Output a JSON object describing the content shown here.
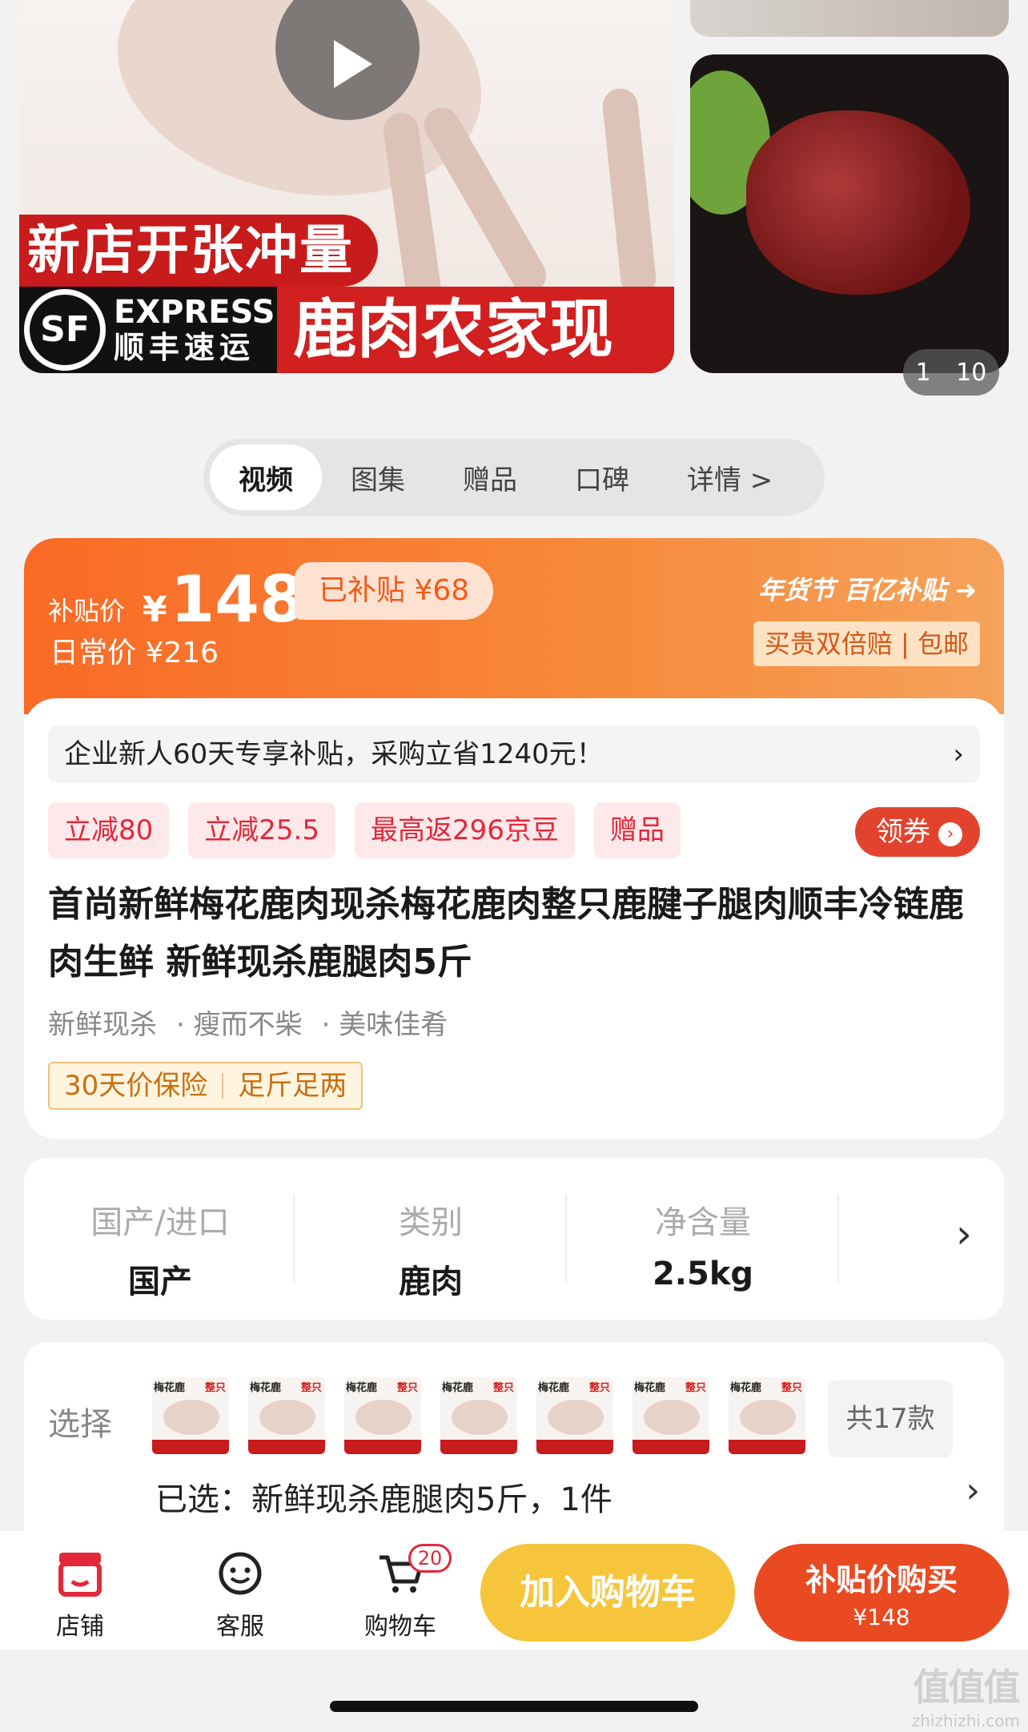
{
  "media": {
    "promo_line": "新店开张冲量",
    "sf_logo": "SF",
    "sf_en": "EXPRESS",
    "sf_cn": "顺丰速运",
    "banner_text": "鹿肉农家现杀",
    "counter_current": "1",
    "counter_total": "10"
  },
  "tabs": [
    {
      "label": "视频",
      "active": true
    },
    {
      "label": "图集"
    },
    {
      "label": "赠品"
    },
    {
      "label": "口碑"
    },
    {
      "label": "详情 >"
    }
  ],
  "price": {
    "subsidy_label": "补贴价",
    "yen": "¥",
    "subsidy_price": "148",
    "saved_text": "已补贴 ¥68",
    "daily_text": "日常价 ¥216",
    "event_text": "年货节 百亿补贴",
    "event_icon": "chevron-circle-icon",
    "badge_text": "买贵双倍赔 | 包邮"
  },
  "notice": {
    "text": "企业新人60天专享补贴，采购立省1240元！",
    "chevron": "›"
  },
  "tags": [
    "立减80",
    "立减25.5",
    "最高返296京豆",
    "赠品"
  ],
  "coupon": {
    "label": "领券",
    "icon": "›"
  },
  "product": {
    "title": "首尚新鲜梅花鹿肉现杀梅花鹿肉整只鹿腱子腿肉顺丰冷链鹿肉生鲜 新鲜现杀鹿腿肉5斤",
    "features": [
      "新鲜现杀",
      "· 瘦而不柴",
      "· 美味佳肴"
    ],
    "services": [
      "30天价保险",
      "足斤足两"
    ]
  },
  "specs": [
    {
      "key": "国产/进口",
      "value": "国产"
    },
    {
      "key": "类别",
      "value": "鹿肉"
    },
    {
      "key": "净含量",
      "value": "2.5kg"
    }
  ],
  "spec_chevron": "›",
  "select": {
    "label": "选择",
    "thumb_text_a": "梅花鹿",
    "thumb_text_b": "整只",
    "thumb_count": 7,
    "more_label": "共17款",
    "selected_text": "已选：新鲜现杀鹿腿肉5斤，1件",
    "chevron": "›"
  },
  "bottom_bar": {
    "shop_label": "店铺",
    "service_label": "客服",
    "cart_label": "购物车",
    "cart_badge": "20",
    "add_to_cart": "加入购物车",
    "buy_label": "补贴价购买",
    "buy_price": "¥148"
  },
  "watermark": {
    "glyphs": "值值值",
    "site": "zhizhizhi.com"
  },
  "colors": {
    "accent_orange": "#f96a25",
    "red": "#e2283a",
    "cart_yellow": "#f7c53b",
    "buy_red": "#ea4a22"
  }
}
